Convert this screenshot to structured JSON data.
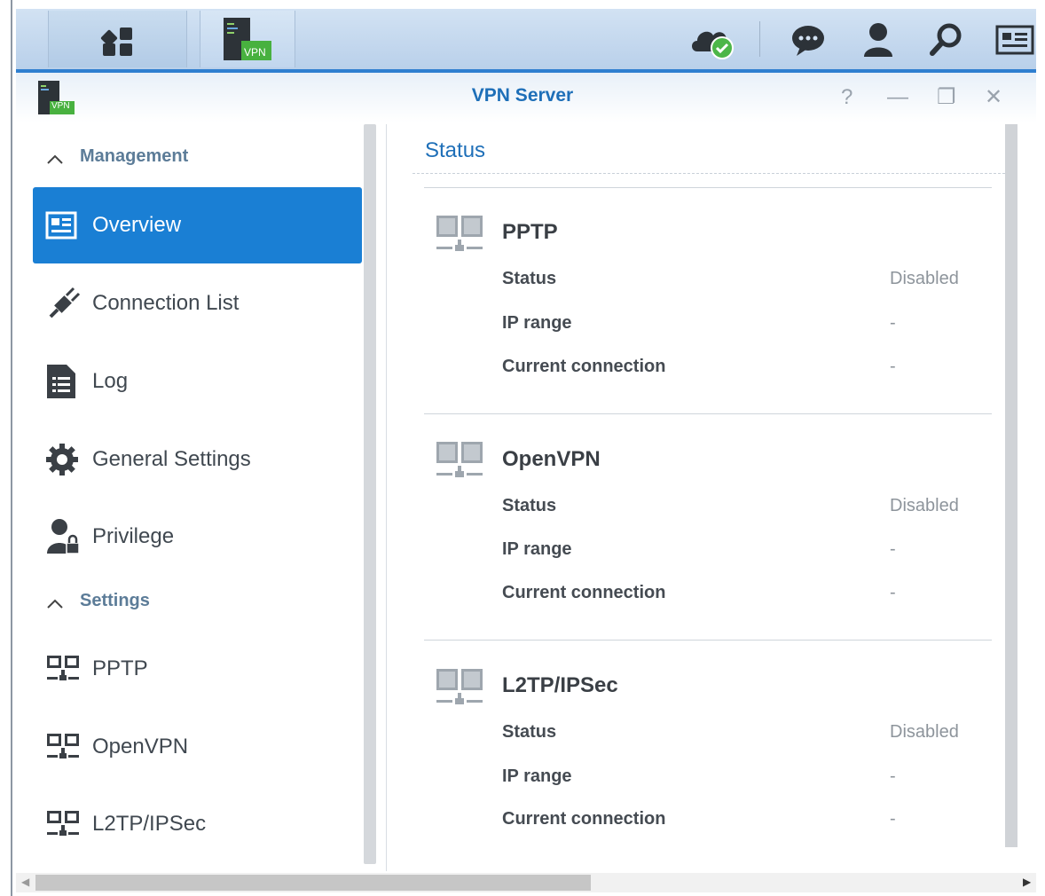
{
  "taskbar": {
    "apps": [
      {
        "name": "main-menu",
        "icon": "grid-menu-icon"
      },
      {
        "name": "vpn-server",
        "icon": "vpn-server-icon",
        "badge": "VPN"
      }
    ],
    "tray_icons": [
      "cloud-sync-icon",
      "chat-icon",
      "user-icon",
      "search-icon",
      "widgets-icon"
    ]
  },
  "window": {
    "title": "VPN Server",
    "app_badge": "VPN",
    "controls": {
      "help": "?",
      "minimize": "—",
      "restore": "❐",
      "close": "✕"
    }
  },
  "sidebar": {
    "sections": [
      {
        "label": "Management"
      },
      {
        "label": "Settings"
      }
    ],
    "items": [
      {
        "label": "Overview",
        "icon": "overview-card-icon",
        "selected": true
      },
      {
        "label": "Connection List",
        "icon": "plug-icon"
      },
      {
        "label": "Log",
        "icon": "log-document-icon"
      },
      {
        "label": "General Settings",
        "icon": "gear-icon"
      },
      {
        "label": "Privilege",
        "icon": "user-lock-icon"
      },
      {
        "label": "PPTP",
        "icon": "network-icon"
      },
      {
        "label": "OpenVPN",
        "icon": "network-icon"
      },
      {
        "label": "L2TP/IPSec",
        "icon": "network-icon"
      }
    ]
  },
  "main": {
    "title": "Status",
    "protocols": [
      {
        "name": "PPTP",
        "rows": [
          {
            "label": "Status",
            "value": "Disabled"
          },
          {
            "label": "IP range",
            "value": "-"
          },
          {
            "label": "Current connection",
            "value": "-"
          }
        ]
      },
      {
        "name": "OpenVPN",
        "rows": [
          {
            "label": "Status",
            "value": "Disabled"
          },
          {
            "label": "IP range",
            "value": "-"
          },
          {
            "label": "Current connection",
            "value": "-"
          }
        ]
      },
      {
        "name": "L2TP/IPSec",
        "rows": [
          {
            "label": "Status",
            "value": "Disabled"
          },
          {
            "label": "IP range",
            "value": "-"
          },
          {
            "label": "Current connection",
            "value": "-"
          }
        ]
      }
    ]
  },
  "colors": {
    "accent": "#1a7fd4",
    "title_blue": "#1e6fb8",
    "vpn_green": "#4caf50"
  }
}
